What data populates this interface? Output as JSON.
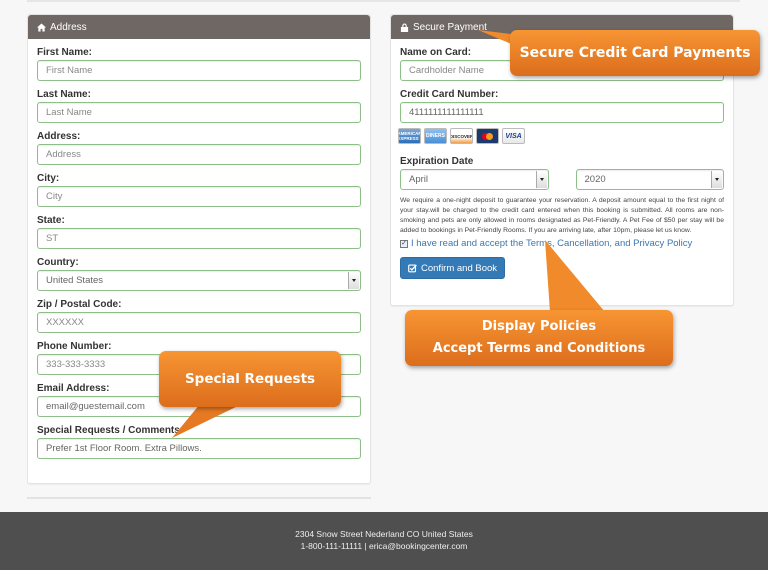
{
  "address_panel": {
    "title": "Address",
    "icon": "home-icon",
    "fields": [
      {
        "label": "First Name:",
        "value": "First Name",
        "type": "text"
      },
      {
        "label": "Last Name:",
        "value": "Last Name",
        "type": "text"
      },
      {
        "label": "Address:",
        "value": "Address",
        "type": "text"
      },
      {
        "label": "City:",
        "value": "City",
        "type": "text"
      },
      {
        "label": "State:",
        "value": "ST",
        "type": "text"
      },
      {
        "label": "Country:",
        "value": "United States",
        "type": "select"
      },
      {
        "label": "Zip / Postal Code:",
        "value": "XXXXXX",
        "type": "text"
      },
      {
        "label": "Phone Number:",
        "value": "333-333-3333",
        "type": "text"
      },
      {
        "label": "Email Address:",
        "value": "email@guestemail.com",
        "type": "text"
      },
      {
        "label": "Special Requests / Comments:",
        "value": "Prefer 1st Floor Room. Extra Pillows.",
        "type": "text"
      }
    ]
  },
  "payment_panel": {
    "title": "Secure Payment",
    "icon": "lock-icon",
    "name_label": "Name on Card:",
    "name_placeholder": "Cardholder Name",
    "number_label": "Credit Card Number:",
    "number_value": "4111111111111111",
    "card_logos": [
      "AMERICAN EXPRESS",
      "DINERS",
      "DISCOVER",
      "MasterCard",
      "VISA"
    ],
    "expiration_label": "Expiration Date",
    "exp_month": "April",
    "exp_year": "2020",
    "policy_text": "We require a one-night deposit to guarantee your reservation. A deposit amount equal to the first night of your stay.will be charged to the credit card entered when this booking is submitted. All rooms are non-smoking and pets are only allowed in rooms designated as Pet-Friendly. A Pet Fee of $50 per stay will be added to bookings in Pet-Friendly Rooms. If you are arriving late, after 10pm, please let us know.",
    "accept_label": "I have read and accept the Terms, Cancellation, and Privacy Policy",
    "accept_checked": true,
    "confirm_label": "Confirm and Book"
  },
  "callouts": {
    "secure": "Secure Credit Card Payments",
    "policies_line1": "Display Policies",
    "policies_line2": "Accept Terms and Conditions",
    "requests": "Special Requests"
  },
  "footer": {
    "address": "2304 Snow Street Nederland CO United States",
    "contact": "1-800-111-11111 | erica@bookingcenter.com"
  },
  "colors": {
    "panel_header": "#6e6764",
    "input_border": "#8ebf89",
    "primary_button": "#337ab7",
    "callout": "#f08a2a",
    "footer": "#4f4f4f"
  }
}
